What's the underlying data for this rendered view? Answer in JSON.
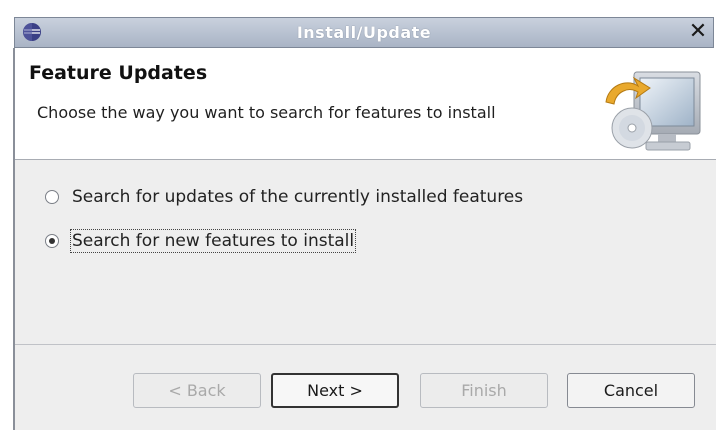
{
  "window": {
    "title": "Install/Update"
  },
  "header": {
    "title": "Feature Updates",
    "description": "Choose the way you want to search for features to install"
  },
  "options": [
    {
      "label": "Search for updates of the currently installed features",
      "selected": false
    },
    {
      "label": "Search for new features to install",
      "selected": true
    }
  ],
  "buttons": {
    "back": "< Back",
    "next": "Next >",
    "finish": "Finish",
    "cancel": "Cancel"
  },
  "icons": [
    "eclipse-app-icon",
    "close-icon",
    "install-update-graphic"
  ]
}
